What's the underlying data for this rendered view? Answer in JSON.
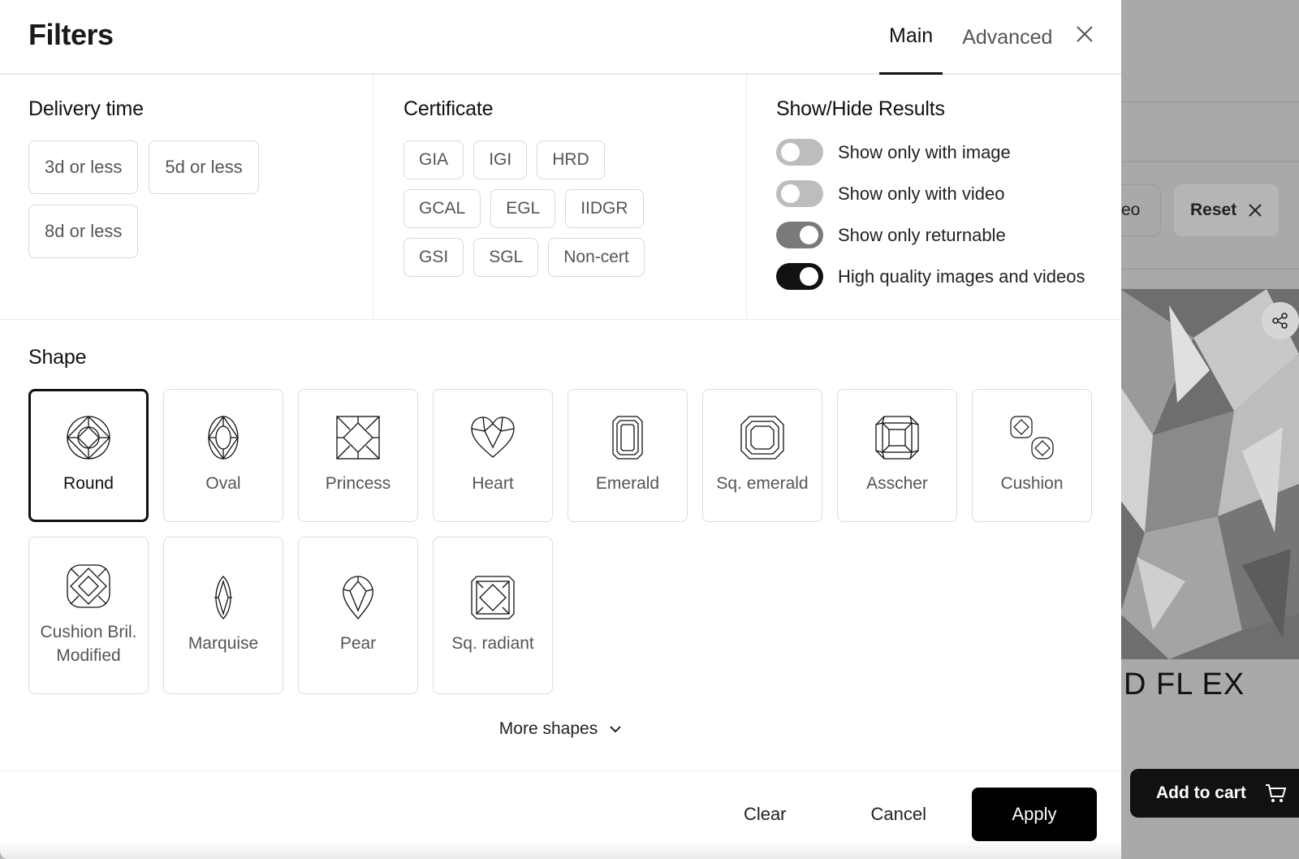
{
  "background": {
    "chip_partial": "eo",
    "reset_label": "Reset",
    "product_title": "D FL EX",
    "add_to_cart_label": "Add to cart"
  },
  "header": {
    "title": "Filters",
    "tabs": [
      {
        "label": "Main",
        "active": true
      },
      {
        "label": "Advanced",
        "active": false
      }
    ]
  },
  "delivery": {
    "title": "Delivery time",
    "options": [
      "3d or less",
      "5d or less",
      "8d or less"
    ]
  },
  "certificate": {
    "title": "Certificate",
    "options": [
      "GIA",
      "IGI",
      "HRD",
      "GCAL",
      "EGL",
      "IIDGR",
      "GSI",
      "SGL",
      "Non-cert"
    ]
  },
  "show_hide": {
    "title": "Show/Hide Results",
    "toggles": [
      {
        "label": "Show only with image",
        "state": "off"
      },
      {
        "label": "Show only with video",
        "state": "off"
      },
      {
        "label": "Show only returnable",
        "state": "on-disabled"
      },
      {
        "label": "High quality images and videos",
        "state": "on"
      }
    ]
  },
  "shape": {
    "title": "Shape",
    "items": [
      {
        "label": "Round",
        "icon": "round-icon",
        "selected": true
      },
      {
        "label": "Oval",
        "icon": "oval-icon",
        "selected": false
      },
      {
        "label": "Princess",
        "icon": "princess-icon",
        "selected": false
      },
      {
        "label": "Heart",
        "icon": "heart-icon",
        "selected": false
      },
      {
        "label": "Emerald",
        "icon": "emerald-icon",
        "selected": false
      },
      {
        "label": "Sq. emerald",
        "icon": "sq-emerald-icon",
        "selected": false
      },
      {
        "label": "Asscher",
        "icon": "asscher-icon",
        "selected": false
      },
      {
        "label": "Cushion",
        "icon": "cushion-icon",
        "selected": false
      },
      {
        "label": "Cushion Bril. Modified",
        "icon": "cushion-bril-modified-icon",
        "selected": false
      },
      {
        "label": "Marquise",
        "icon": "marquise-icon",
        "selected": false
      },
      {
        "label": "Pear",
        "icon": "pear-icon",
        "selected": false
      },
      {
        "label": "Sq. radiant",
        "icon": "sq-radiant-icon",
        "selected": false
      }
    ],
    "more_label": "More shapes"
  },
  "footer": {
    "clear_label": "Clear",
    "cancel_label": "Cancel",
    "apply_label": "Apply"
  }
}
